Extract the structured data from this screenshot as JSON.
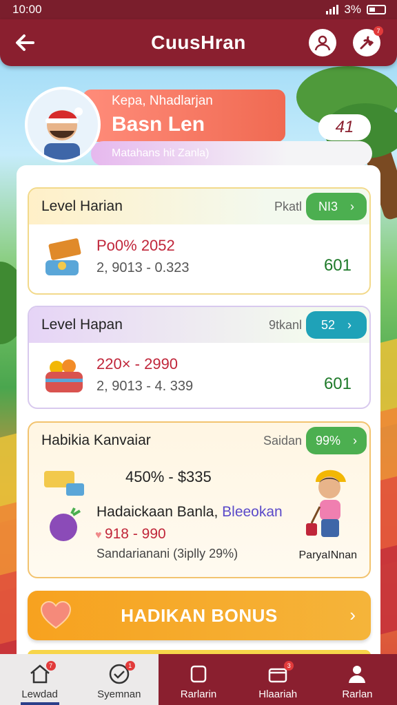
{
  "status_bar": {
    "time": "10:00",
    "battery": "3%"
  },
  "app_bar": {
    "back_icon": "arrow-left-icon",
    "title": "CuusHran",
    "profile_icon": "user-icon",
    "tools_icon": "wrench-icon",
    "tools_badge": "7"
  },
  "profile": {
    "greeting": "Kepa, Nhadlarjan",
    "name": "Basn Len",
    "subtitle": "Matahans hit Zanla)",
    "cloud_value": "41"
  },
  "cards": [
    {
      "title": "Level Harian",
      "meta": "Pkatl",
      "pill_value": "NI3",
      "pill_color": "#4caf50",
      "price": "Po0% 2052",
      "range": "2, 9013 - 0.323",
      "number": "601"
    },
    {
      "title": "Level Hapan",
      "meta": "9tkanl",
      "pill_value": "52",
      "pill_color": "#1fa2b8",
      "price": "220× - 2990",
      "range": "2, 9013 - 4. 339",
      "number": "601"
    }
  ],
  "special_card": {
    "title": "Habikia Kanvaiar",
    "meta": "Saidan",
    "pill_value": "99%",
    "pill_color": "#4caf50",
    "price": "450% - $335",
    "line_black": "Hadaickaan Banla,",
    "line_blue": "Bleeokan",
    "red_value": "918 - 990",
    "footer": "Sandarianani (3iplly 29%)",
    "character_name": "ParyaINnan"
  },
  "bonus_button": {
    "label": "HADIKAN BONUS"
  },
  "bottom_nav": [
    {
      "label": "Lewdad",
      "icon": "home-icon",
      "badge": "7"
    },
    {
      "label": "Syemnan",
      "icon": "checkmark-circle-icon",
      "badge": "1"
    },
    {
      "label": "Rarlarin",
      "icon": "square-icon",
      "badge": ""
    },
    {
      "label": "Hlaariah",
      "icon": "box-icon",
      "badge": "3"
    },
    {
      "label": "Rarlan",
      "icon": "user-icon",
      "badge": ""
    }
  ],
  "colors": {
    "brand": "#8a1f2f",
    "accent": "#f7a21f",
    "positive": "#1f7a2a",
    "price": "#c0263a"
  }
}
